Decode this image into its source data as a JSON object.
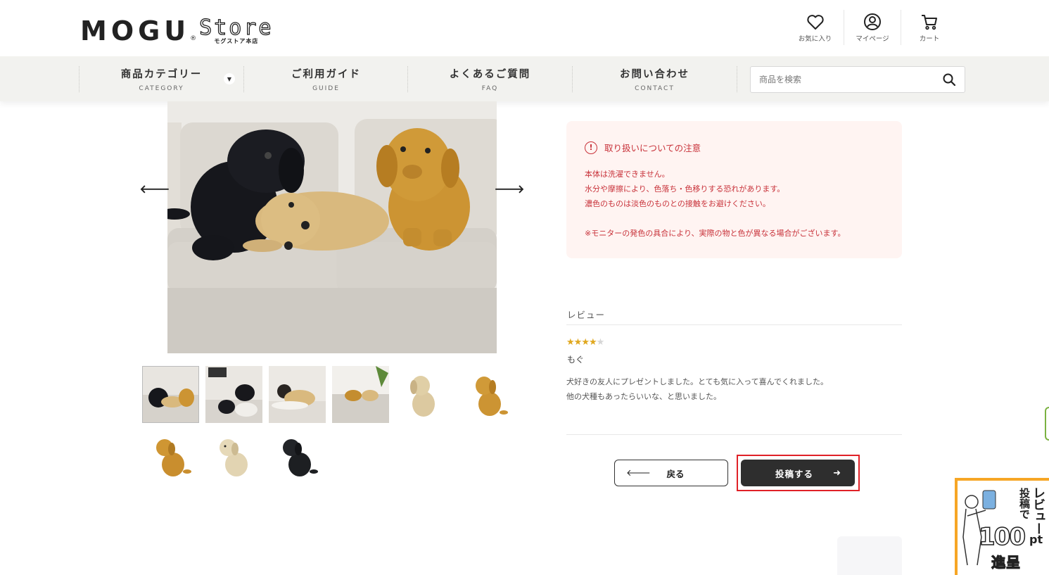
{
  "brand": {
    "logo_main": "MOGU",
    "logo_reg": "®",
    "logo_store": "Store",
    "logo_sub": "モグストア本店"
  },
  "header_icons": [
    {
      "name": "favorites",
      "label": "お気に入り",
      "icon": "heart-icon"
    },
    {
      "name": "mypage",
      "label": "マイページ",
      "icon": "user-icon"
    },
    {
      "name": "cart",
      "label": "カート",
      "icon": "cart-icon"
    }
  ],
  "nav": {
    "items": [
      {
        "jp": "商品カテゴリー",
        "en": "CATEGORY"
      },
      {
        "jp": "ご利用ガイド",
        "en": "GUIDE"
      },
      {
        "jp": "よくあるご質問",
        "en": "FAQ"
      },
      {
        "jp": "お問い合わせ",
        "en": "CONTACT"
      }
    ],
    "search_placeholder": "商品を検索"
  },
  "gallery": {
    "prev_arrow": "🡐",
    "next_arrow": "🡒",
    "thumbnail_count": 9,
    "selected_index": 0
  },
  "caution": {
    "title": "取り扱いについての注意",
    "icon_glyph": "!",
    "lines": [
      "本体は洗濯できません。",
      "水分や摩擦により、色落ち・色移りする恐れがあります。",
      "濃色のものは淡色のものとの接触をお避けください。"
    ],
    "note": "※モニターの発色の具合により、実際の物と色が異なる場合がございます。"
  },
  "review": {
    "heading": "レビュー",
    "rating": 4,
    "max_rating": 5,
    "author": "もぐ",
    "body_line1": "犬好きの友人にプレゼントしました。とても気に入って喜んでくれました。",
    "body_line2": "他の犬種もあったらいいな、と思いました。"
  },
  "buttons": {
    "back_label": "戻る",
    "back_arrow": "🡐",
    "submit_label": "投稿する",
    "submit_arrow": "➜"
  },
  "promo": {
    "line1": "レビュー",
    "line2": "投稿で",
    "points": "100",
    "unit": "pt",
    "line3": "進呈"
  },
  "colors": {
    "accent_red": "#c8323a",
    "caution_bg": "#fff4f2",
    "nav_bg": "#f2f2ef",
    "button_dark": "#2e2e2e",
    "highlight_border": "#e02127",
    "star": "#e0a820",
    "promo_orange": "#f6a625"
  }
}
